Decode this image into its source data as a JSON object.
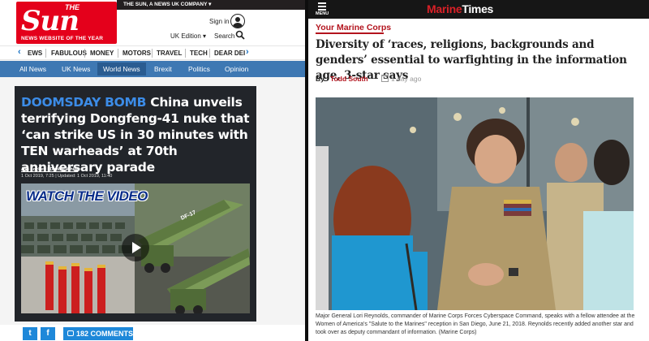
{
  "sun": {
    "logo": {
      "the": "THE",
      "name": "Sun",
      "tagline": "NEWS WEBSITE OF THE YEAR"
    },
    "company_bar": "THE SUN, A NEWS UK COMPANY ▾",
    "sign_in": "Sign in",
    "edition": "UK Edition ▾",
    "search": "Search",
    "nav": [
      "EWS",
      "FABULOUS",
      "MONEY",
      "MOTORS",
      "TRAVEL",
      "TECH",
      "DEAR DEI"
    ],
    "subnav": [
      "All News",
      "UK News",
      "World News",
      "Brexit",
      "Politics",
      "Opinion"
    ],
    "active_subnav": "World News",
    "article": {
      "kicker": "DOOMSDAY BOMB",
      "headline": "China unveils terrifying Dongfeng-41 nuke that ‘can strike US in 30 minutes with TEN warheads’ at 70th anniversary parade",
      "authors": "Jon Lockett | Debbie White",
      "dates": "1 Oct 2019, 7:25 | Updated: 1 Oct 2019, 11:40",
      "video_label": "WATCH THE VIDEO",
      "missile_label": "DF-17"
    },
    "share": {
      "twitter": "t",
      "facebook": "f",
      "comments": "182 COMMENTS"
    }
  },
  "marinetimes": {
    "menu": "MENU",
    "logo_a": "Marine",
    "logo_b": "Times",
    "section": "Your Marine Corps",
    "title": "Diversity of ‘races, religions, backgrounds and genders’ essential to warfighting in the information age, 3-star says",
    "by": "By:",
    "author": "Todd South",
    "date": "1 day ago",
    "caption": "Major General Lori Reynolds, commander of Marine Corps Forces Cyberspace Command, speaks with a fellow attendee at the Women of America's \"Salute to the Marines\" reception in San Diego, June 21, 2018. Reynolds recently added another star and took over as deputy commandant of information. (Marine Corps)"
  },
  "colors": {
    "sun_red": "#e4001b",
    "sun_blue": "#3e78b3",
    "kicker_blue": "#3c8ce7",
    "mt_red": "#b3141e"
  }
}
